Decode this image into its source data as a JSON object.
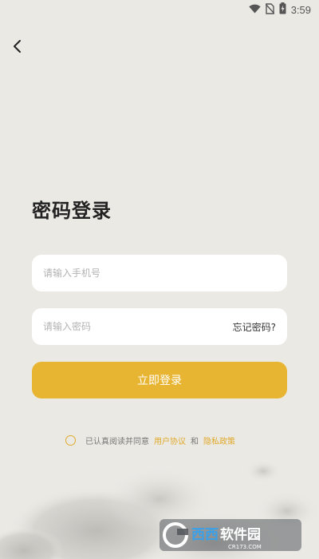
{
  "status_bar": {
    "time": "3:59",
    "icons": [
      "wifi-icon",
      "no-sim-icon",
      "battery-charging-icon"
    ]
  },
  "nav": {
    "back_icon": "chevron-left-icon"
  },
  "login": {
    "title": "密码登录",
    "phone_placeholder": "请输入手机号",
    "phone_value": "",
    "password_placeholder": "请输入密码",
    "password_value": "",
    "forgot_label": "忘记密码?",
    "submit_label": "立即登录"
  },
  "agreement": {
    "prefix": "已认真阅读并同意",
    "user_agreement": "用户协议",
    "and": "和",
    "privacy_policy": "隐私政策",
    "checked": false
  },
  "watermark": {
    "brand": "西西软件园",
    "url": "CR173.COM"
  },
  "colors": {
    "background": "#ebe9e4",
    "accent": "#e8b532",
    "link": "#e0a92a"
  }
}
